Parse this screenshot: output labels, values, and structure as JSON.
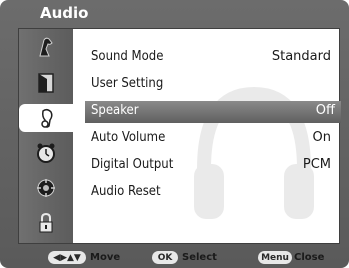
{
  "title": "Audio",
  "sidebar": {
    "items": [
      {
        "icon": "picture-icon"
      },
      {
        "icon": "screen-icon"
      },
      {
        "icon": "audio-icon",
        "active": true
      },
      {
        "icon": "clock-icon"
      },
      {
        "icon": "setup-icon"
      },
      {
        "icon": "lock-icon"
      }
    ]
  },
  "menu": {
    "items": [
      {
        "label": "Sound Mode",
        "value": "Standard"
      },
      {
        "label": "User Setting",
        "value": ""
      },
      {
        "label": "Speaker",
        "value": "Off",
        "selected": true
      },
      {
        "label": "Auto Volume",
        "value": "On"
      },
      {
        "label": "Digital Output",
        "value": "PCM"
      },
      {
        "label": "Audio Reset",
        "value": ""
      }
    ]
  },
  "footer": {
    "move_key": "◀▶▲▼",
    "move_label": "Move",
    "select_key": "OK",
    "select_label": "Select",
    "close_key": "Menu",
    "close_label": "Close"
  },
  "colors": {
    "frame": "#636363",
    "selected_row": "#6f6f6f",
    "content_bg": "#ffffff"
  }
}
